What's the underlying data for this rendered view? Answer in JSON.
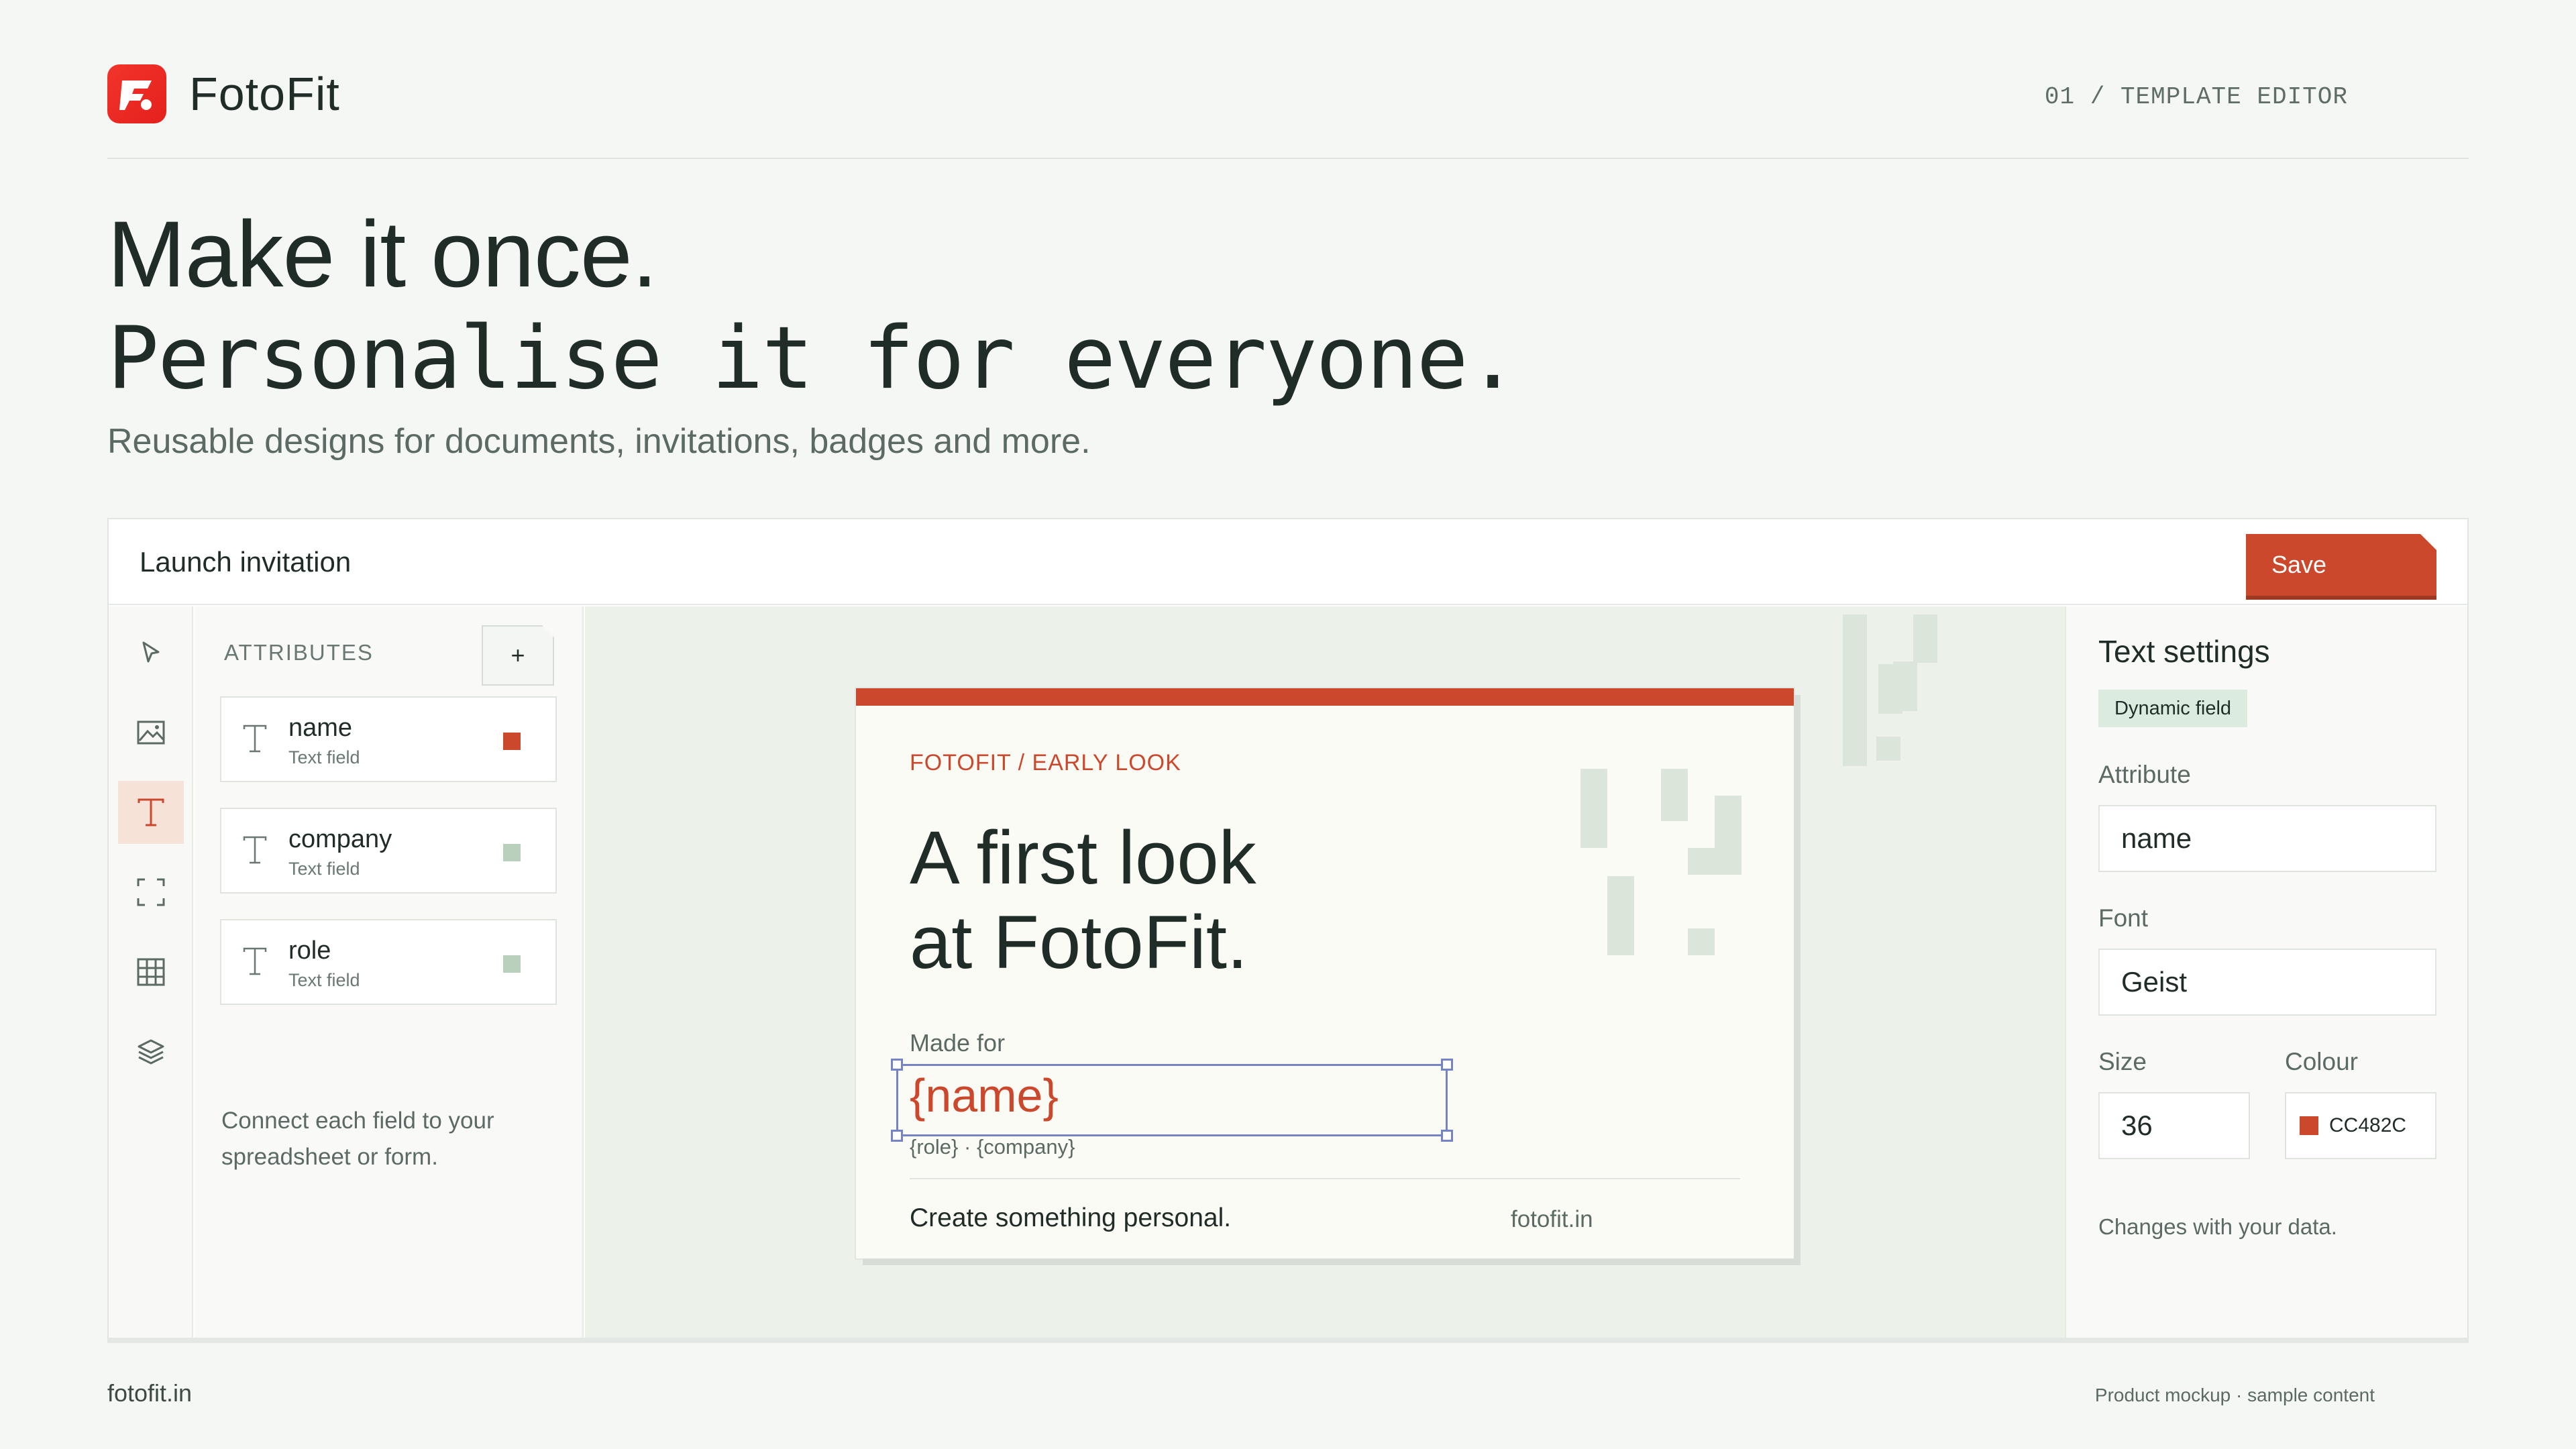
{
  "brand": {
    "name": "FotoFit",
    "accent": "#cc482c",
    "logo_color": "#e4201d"
  },
  "header": {
    "step_label": "01 / TEMPLATE EDITOR"
  },
  "hero": {
    "line1": "Make it once.",
    "line2": "Personalise it for everyone.",
    "subtitle": "Reusable designs for documents, invitations, badges and more."
  },
  "editor": {
    "document_title": "Launch invitation",
    "save_label": "Save",
    "toolbar": [
      {
        "icon": "pointer-icon"
      },
      {
        "icon": "image-icon"
      },
      {
        "icon": "text-icon",
        "active": true
      },
      {
        "icon": "frame-icon"
      },
      {
        "icon": "table-icon"
      },
      {
        "icon": "layers-icon"
      }
    ],
    "attributes": {
      "heading": "ATTRIBUTES",
      "add_label": "+",
      "items": [
        {
          "name": "name",
          "type": "Text field",
          "color": "#cc482c"
        },
        {
          "name": "company",
          "type": "Text field",
          "color": "#b9d0bd"
        },
        {
          "name": "role",
          "type": "Text field",
          "color": "#b9d0bd"
        }
      ],
      "hint": "Connect each field to your spreadsheet or form."
    },
    "card": {
      "kicker": "FOTOFIT / EARLY LOOK",
      "title_line1": "A first look",
      "title_line2": "at FotoFit.",
      "made_for": "Made for",
      "name_token": "{name}",
      "role_line": "{role} · {company}",
      "footer_text": "Create something personal.",
      "footer_url": "fotofit.in"
    },
    "settings": {
      "title": "Text settings",
      "badge": "Dynamic field",
      "attribute_label": "Attribute",
      "attribute_value": "name",
      "font_label": "Font",
      "font_value": "Geist",
      "size_label": "Size",
      "size_value": "36",
      "colour_label": "Colour",
      "colour_value": "CC482C",
      "hint": "Changes with your data."
    }
  },
  "footer": {
    "left": "fotofit.in",
    "right": "Product mockup · sample content"
  }
}
